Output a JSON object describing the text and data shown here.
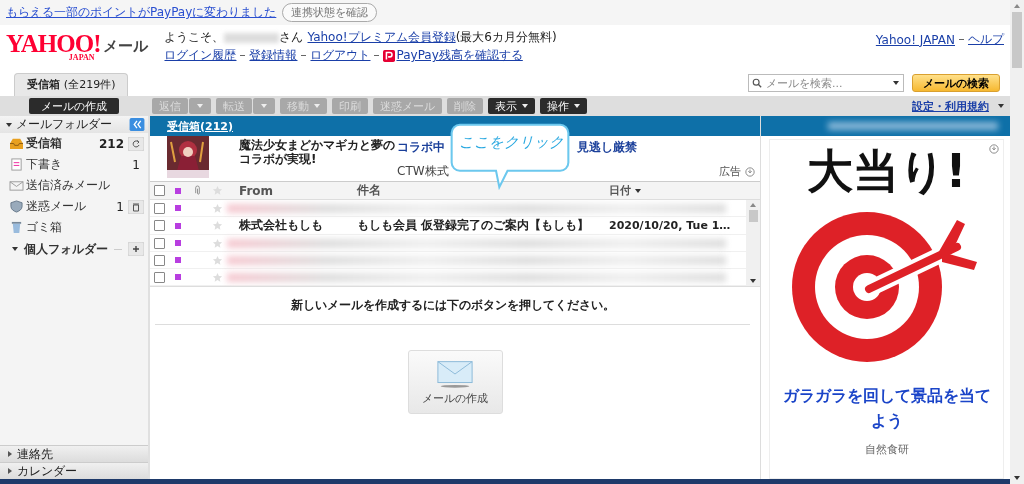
{
  "top_notice": {
    "link": "もらえる一部のポイントがPayPayに変わりました",
    "button": "連携状態を確認"
  },
  "header": {
    "logo": "YAHOO!",
    "logo_sub": "JAPAN",
    "service": "メール",
    "welcome_prefix": "ようこそ、",
    "welcome_suffix": "さん",
    "premium_link": "Yahoo!プレミアム会員登録",
    "premium_note": "(最大6カ月分無料)",
    "links": [
      "ログイン履歴",
      "登録情報",
      "ログアウト"
    ],
    "paypay_link": "PayPay残高を確認する",
    "top_links": [
      "Yahoo! JAPAN",
      "ヘルプ"
    ]
  },
  "tabs": [
    {
      "label": "受信箱",
      "count": "(全219件)",
      "selected": true
    }
  ],
  "search": {
    "placeholder": "メールを検索...",
    "button": "メールの検索"
  },
  "compose_button": "メールの作成",
  "toolbar": [
    {
      "label": "返信",
      "disabled": true,
      "kind": "split"
    },
    {
      "label": "転送",
      "disabled": true,
      "kind": "split"
    },
    {
      "label": "移動",
      "disabled": true,
      "kind": "menu"
    },
    {
      "label": "印刷",
      "disabled": true,
      "kind": "plain"
    },
    {
      "label": "迷惑メール",
      "disabled": true,
      "kind": "plain"
    },
    {
      "label": "削除",
      "disabled": true,
      "kind": "plain"
    },
    {
      "label": "表示",
      "disabled": false,
      "kind": "menu"
    },
    {
      "label": "操作",
      "disabled": false,
      "kind": "menu"
    }
  ],
  "settings_link": "設定・利用規約",
  "sidebar": {
    "header": "メールフォルダー",
    "expanded": true,
    "folders": [
      {
        "name": "受信箱",
        "count": "212",
        "kind": "inbox",
        "unread": true
      },
      {
        "name": "下書き",
        "count": "1",
        "kind": "draft",
        "unread": false
      },
      {
        "name": "送信済みメール",
        "kind": "sent",
        "unread": false
      },
      {
        "name": "迷惑メール",
        "count": "1",
        "kind": "spam",
        "unread": false
      },
      {
        "name": "ゴミ箱",
        "kind": "trash",
        "unread": false
      }
    ],
    "personal": {
      "label": "個人フォルダー",
      "expanded": true
    },
    "bottom": [
      {
        "label": "連絡先",
        "expanded": false
      },
      {
        "label": "カレンダー",
        "expanded": false
      }
    ]
  },
  "main": {
    "folder_title": "受信箱(212)",
    "ad": {
      "title": "魔法少女まどかマギカと夢のコラボが実現!",
      "link_start": "コラボ中",
      "link_end": "見逃し厳禁",
      "sponsor": "CTW株式",
      "label": "広告"
    },
    "columns": [
      "From",
      "件名",
      "日付"
    ],
    "select_all": {
      "checked": false
    },
    "rows": [
      {
        "kind": "blurred",
        "checked": false,
        "starred": false
      },
      {
        "kind": "mail",
        "checked": false,
        "starred": false,
        "from": "株式会社もしも",
        "subject": "もしも会員 仮登録完了のご案内【もしも】",
        "date": "2020/10/20, Tue 1…"
      },
      {
        "kind": "blurred",
        "checked": false,
        "starred": false
      },
      {
        "kind": "blurred",
        "checked": false,
        "starred": false
      },
      {
        "kind": "blurred",
        "checked": false,
        "starred": false
      }
    ],
    "empty_hint": "新しいメールを作成するには下のボタンを押してください。",
    "compose_tile": "メールの作成"
  },
  "callout": "ここをクリック",
  "side_ad": {
    "headline": "大当り!",
    "text": "ガラガラを回して景品を当てよう",
    "sponsor": "自然食研"
  }
}
